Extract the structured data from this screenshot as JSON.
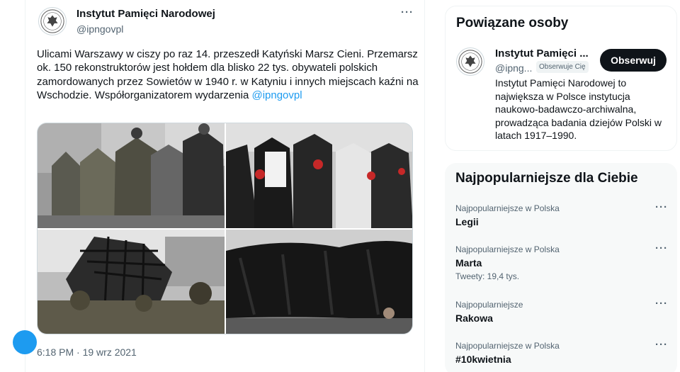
{
  "tweet": {
    "author_name": "Instytut Pamięci Narodowej",
    "author_handle": "@ipngovpl",
    "text": "Ulicami Warszawy w ciszy po raz 14. przeszedł Katyński Marsz Cieni. Przemarsz ok. 150 rekonstruktorów jest hołdem dla blisko 22 tys. obywateli polskich zamordowanych przez Sowietów w 1940 r. w Katyniu i innych miejscach kaźni na Wschodzie. Współorganizatorem wydarzenia ",
    "mention": "@ipngovpl",
    "timestamp": "6:18 PM · 19 wrz 2021",
    "more_icon": "···"
  },
  "related": {
    "heading": "Powiązane osoby",
    "name": "Instytut Pamięci ...",
    "handle": "@ipng...",
    "follows_you": "Obserwuje Cię",
    "follow_label": "Obserwuj",
    "bio": "Instytut Pamięci Narodowej to największa w Polsce instytucja naukowo-badawczo-archiwalna, prowadząca badania dziejów Polski w latach 1917–1990."
  },
  "trends": {
    "heading": "Najpopularniejsze dla Ciebie",
    "items": [
      {
        "context": "Najpopularniejsze w Polska",
        "title": "Legii",
        "count": ""
      },
      {
        "context": "Najpopularniejsze w Polska",
        "title": "Marta",
        "count": "Tweety: 19,4 tys."
      },
      {
        "context": "Najpopularniejsze",
        "title": "Rakowa",
        "count": ""
      },
      {
        "context": "Najpopularniejsze w Polska",
        "title": "#10kwietnia",
        "count": ""
      }
    ]
  },
  "colors": {
    "accent": "#1d9bf0",
    "text": "#0f1419",
    "muted": "#536471"
  }
}
